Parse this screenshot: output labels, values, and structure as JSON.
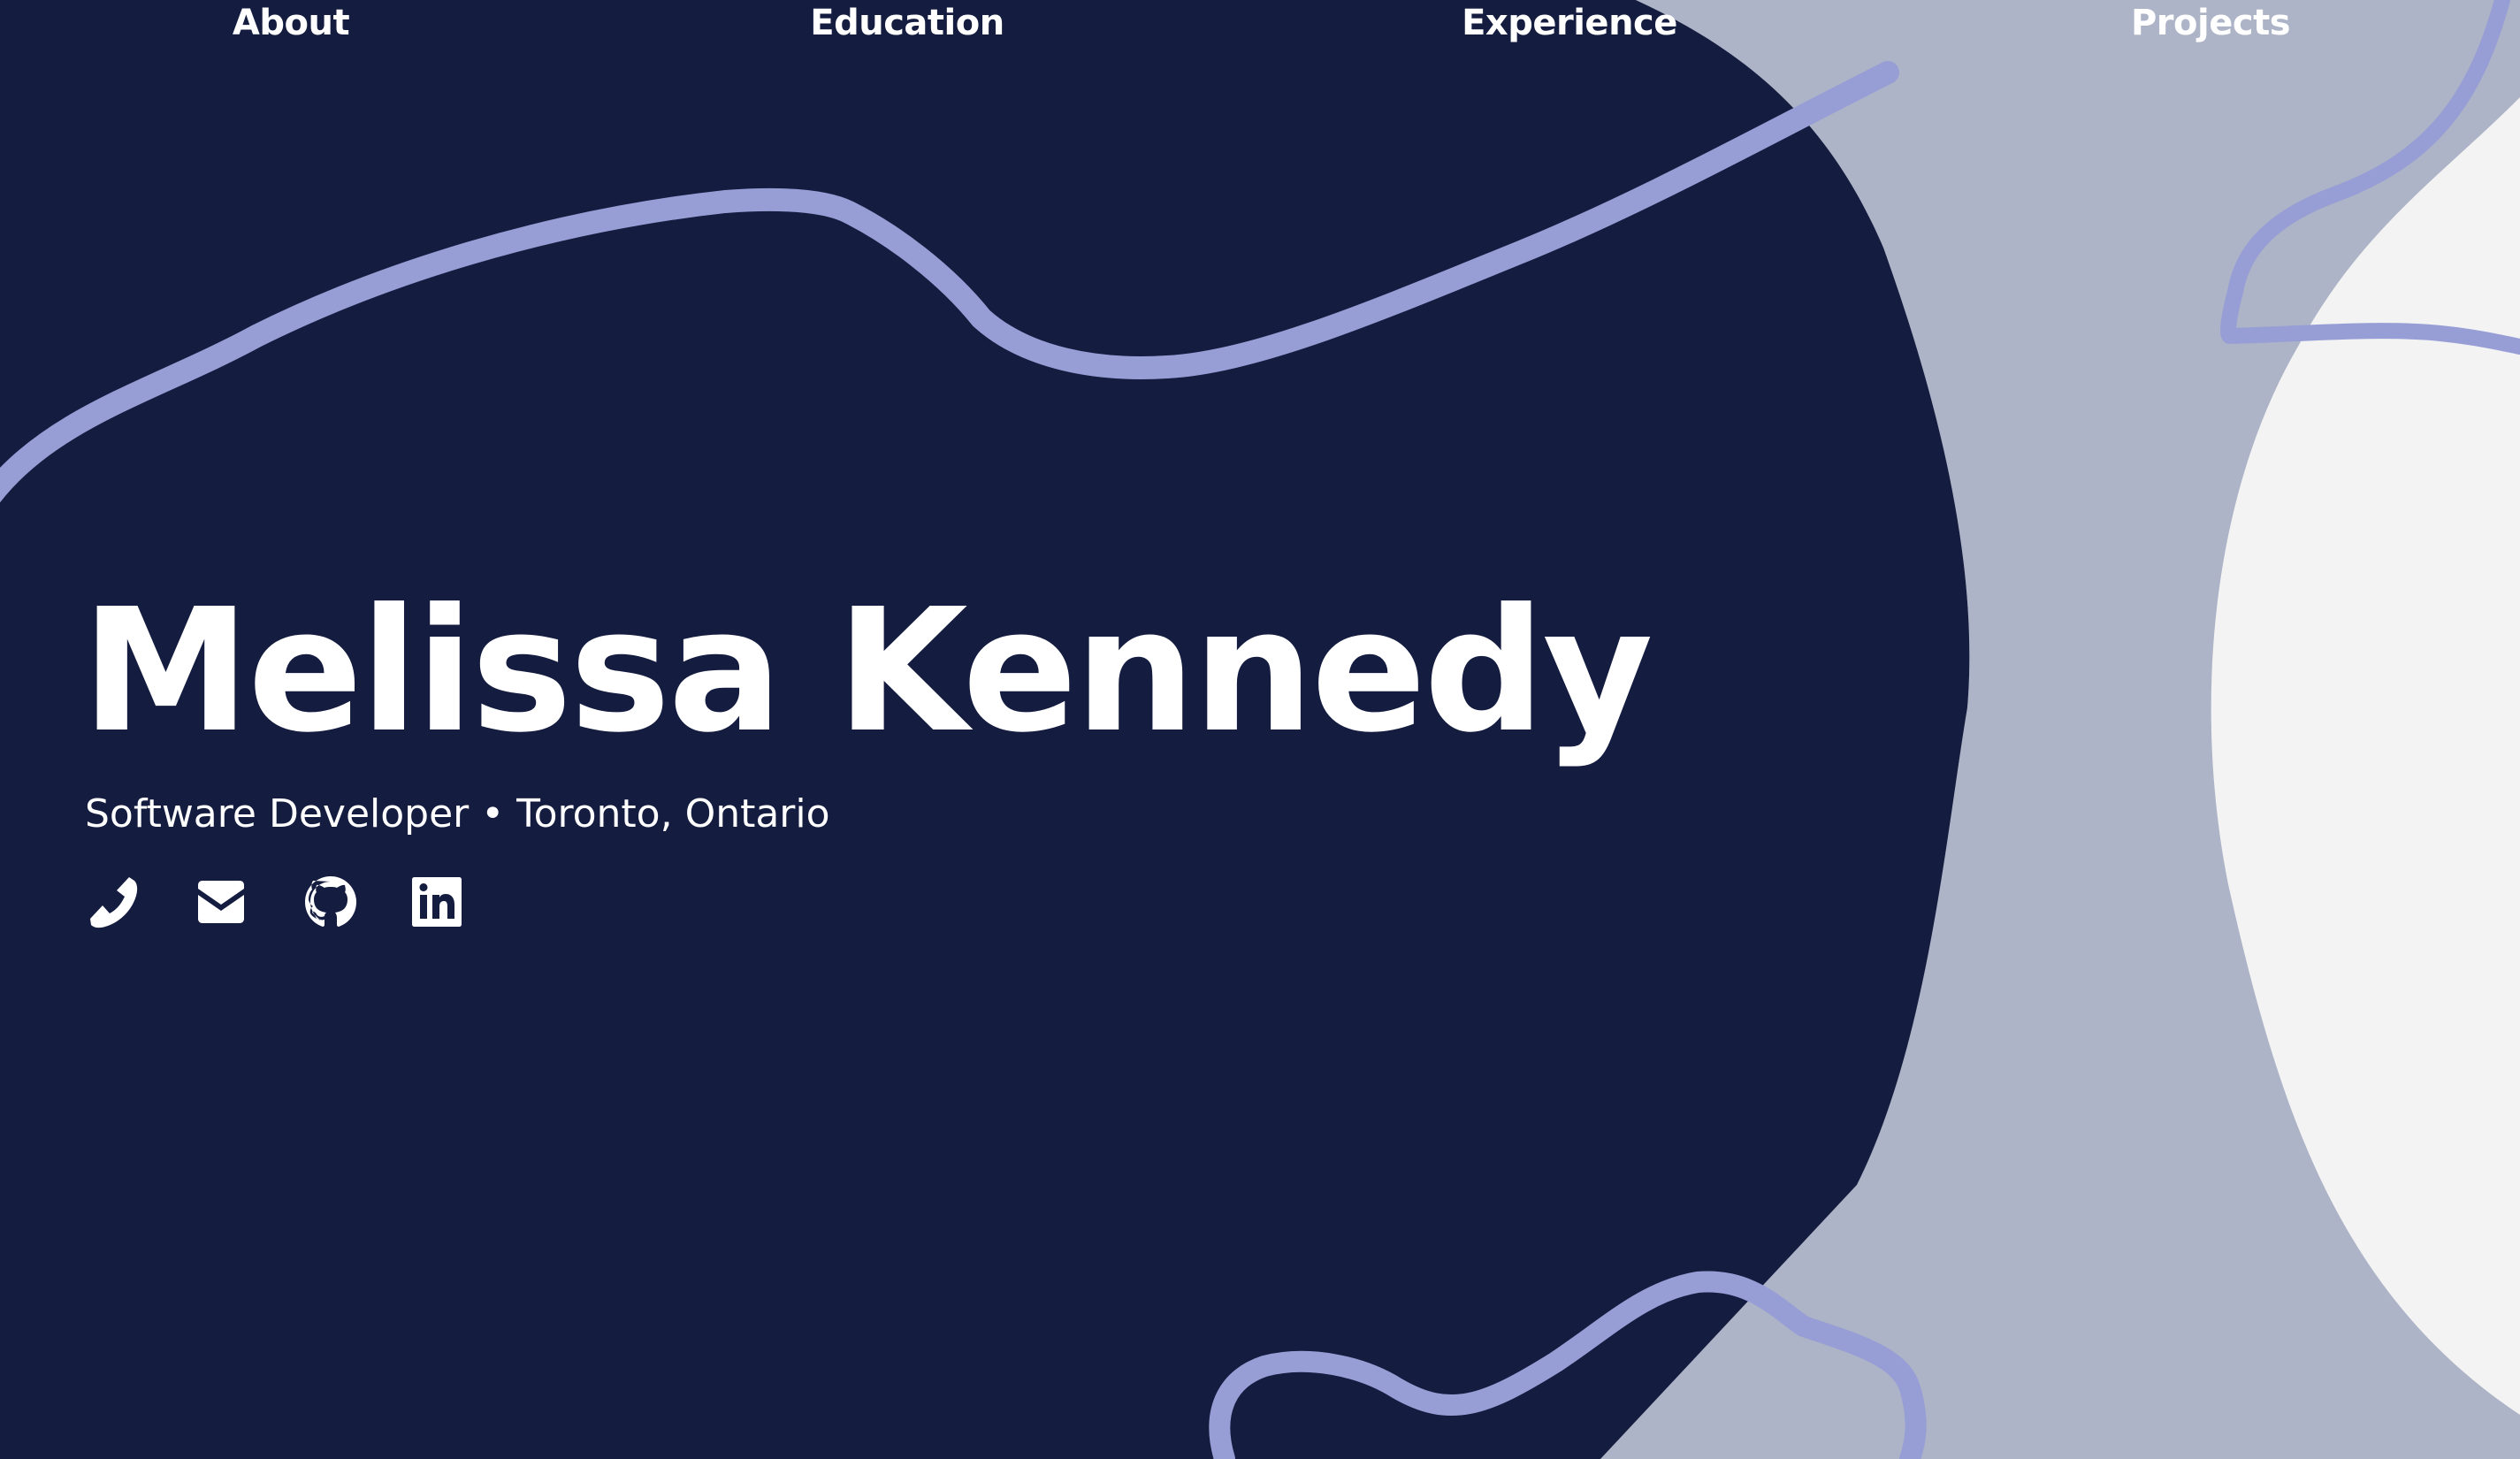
{
  "nav": {
    "items": [
      {
        "label": "About"
      },
      {
        "label": "Education"
      },
      {
        "label": "Experience"
      },
      {
        "label": "Projects"
      }
    ]
  },
  "hero": {
    "name": "Melissa Kennedy",
    "subtitle": "Software Developer • Toronto, Ontario"
  },
  "social": {
    "icons": [
      "phone-icon",
      "envelope-icon",
      "github-icon",
      "linkedin-icon"
    ]
  },
  "colors": {
    "navy": "#141c40",
    "slate": "#adb4c7",
    "light": "#f3f3f3",
    "periwinkle": "#979ed5",
    "text": "#ffffff"
  }
}
